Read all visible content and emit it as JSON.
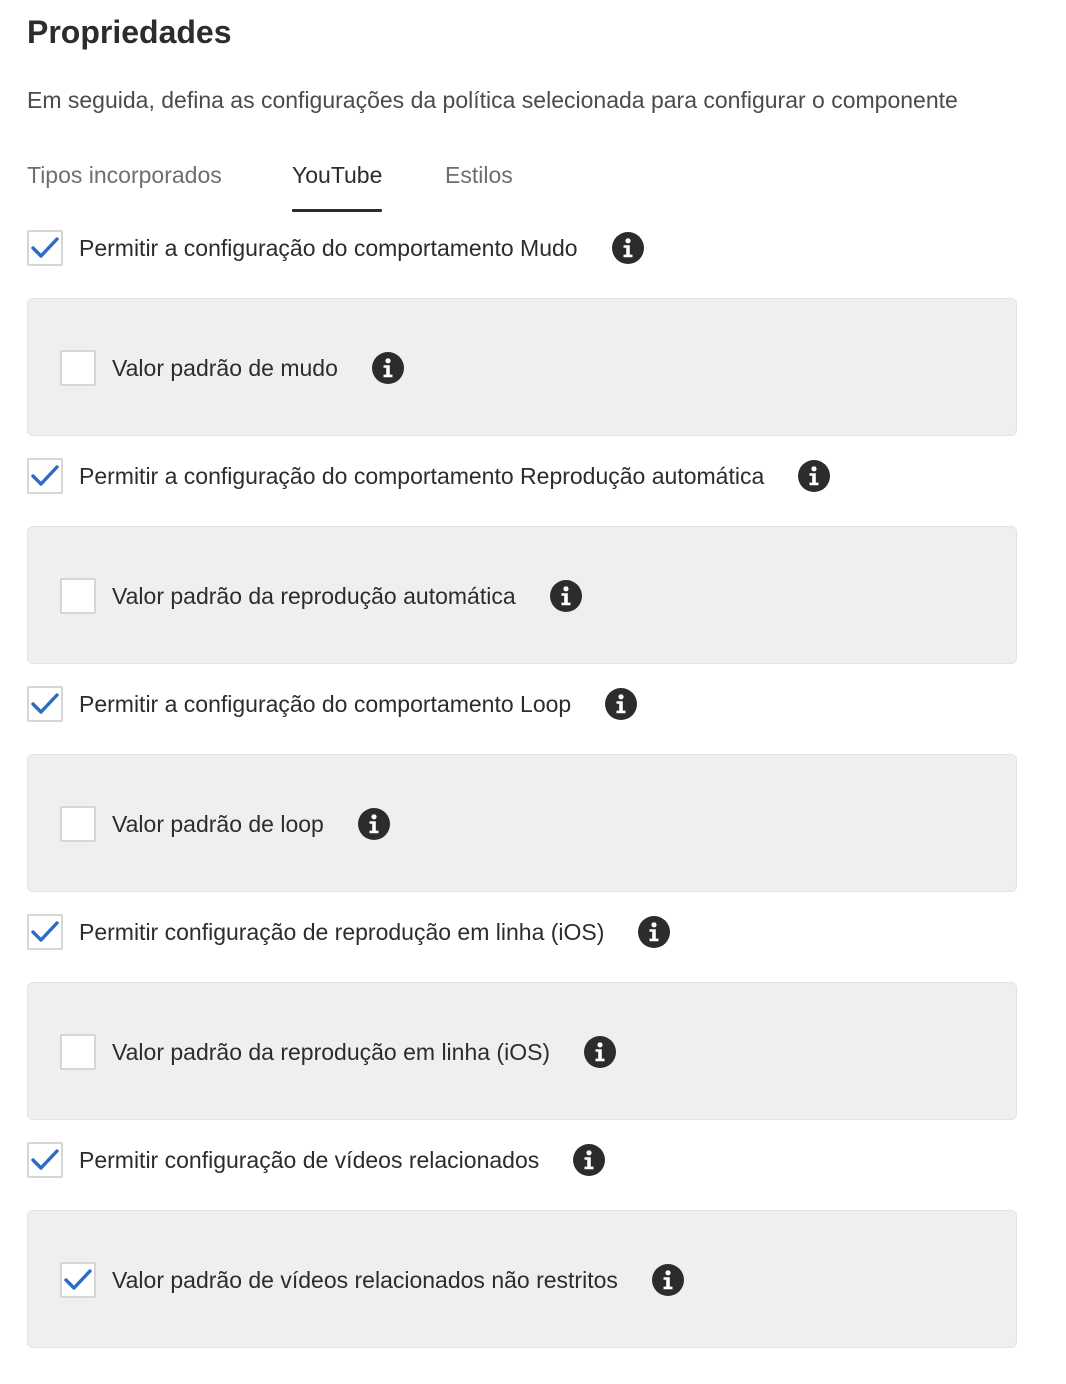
{
  "page": {
    "title": "Propriedades",
    "subtitle": "Em seguida, defina as configurações da política selecionada para configurar o componente"
  },
  "tabs": [
    {
      "label": "Tipos incorporados",
      "active": false
    },
    {
      "label": "YouTube",
      "active": true
    },
    {
      "label": "Estilos",
      "active": false
    }
  ],
  "settings": [
    {
      "label": "Permitir a configuração do comportamento Mudo",
      "checked": true,
      "info_icon": "info-icon",
      "default": {
        "label": "Valor padrão de mudo",
        "checked": false,
        "info_icon": "info-icon"
      }
    },
    {
      "label": "Permitir a configuração do comportamento Reprodução automática",
      "checked": true,
      "info_icon": "info-icon",
      "default": {
        "label": "Valor padrão da reprodução automática",
        "checked": false,
        "info_icon": "info-icon"
      }
    },
    {
      "label": "Permitir a configuração do comportamento Loop",
      "checked": true,
      "info_icon": "info-icon",
      "default": {
        "label": "Valor padrão de loop",
        "checked": false,
        "info_icon": "info-icon"
      }
    },
    {
      "label": "Permitir configuração de reprodução em linha (iOS)",
      "checked": true,
      "info_icon": "info-icon",
      "default": {
        "label": "Valor padrão da reprodução em linha (iOS)",
        "checked": false,
        "info_icon": "info-icon"
      }
    },
    {
      "label": "Permitir configuração de vídeos relacionados",
      "checked": true,
      "info_icon": "info-icon",
      "default": {
        "label": "Valor padrão de vídeos relacionados não restritos",
        "checked": true,
        "info_icon": "info-icon"
      }
    }
  ],
  "colors": {
    "check": "#2d6bc9",
    "panel_bg": "#efefef",
    "text": "#2c2c2c"
  }
}
